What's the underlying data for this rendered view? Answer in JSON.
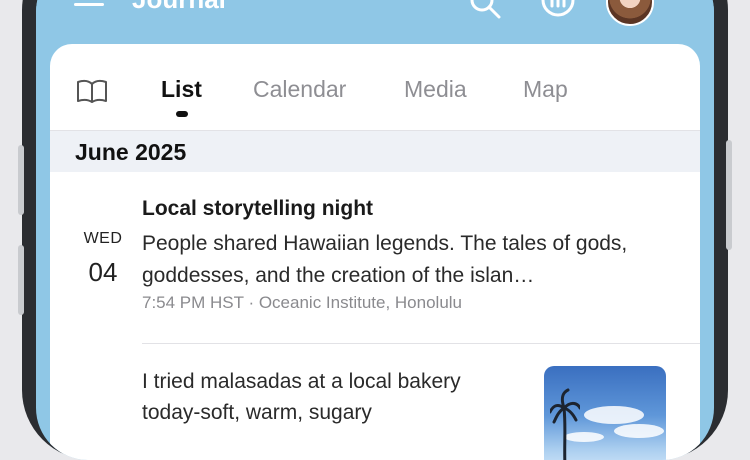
{
  "app_bar": {
    "title": "Journal"
  },
  "tabs": {
    "list": "List",
    "calendar": "Calendar",
    "media": "Media",
    "map": "Map"
  },
  "section": {
    "header": "June 2025"
  },
  "entries": [
    {
      "weekday": "WED",
      "day": "04",
      "title": "Local storytelling night",
      "body": "People shared Hawaiian legends. The tales of gods, goddesses, and the creation of the islan…",
      "meta": "7:54 PM HST · Oceanic Institute, Honolulu"
    },
    {
      "body": "I tried malasadas at a local bakery today-soft, warm, sugary"
    }
  ],
  "colors": {
    "header_blue": "#8fc7e6",
    "section_bg": "#eef1f6"
  }
}
